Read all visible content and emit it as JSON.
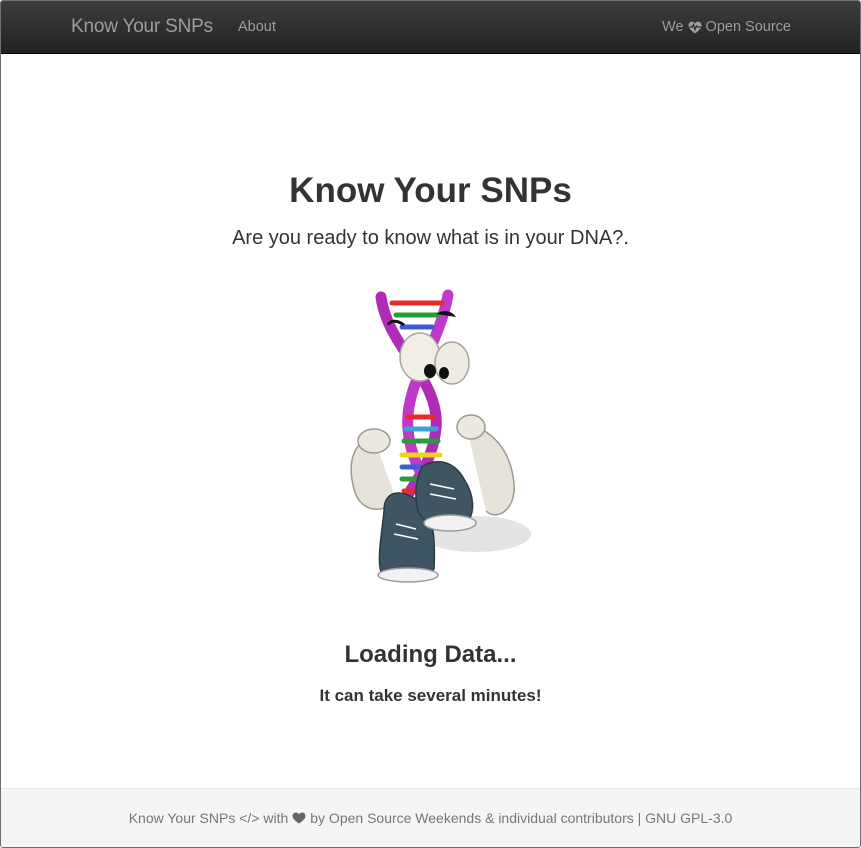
{
  "navbar": {
    "brand": "Know Your SNPs",
    "about": "About",
    "right_prefix": "We",
    "right_icon": "heart-pulse-icon",
    "right_suffix": "Open Source"
  },
  "main": {
    "title": "Know Your SNPs",
    "subtitle": "Are you ready to know what is in your DNA?.",
    "mascot_image": "dna-mascot",
    "loading": "Loading Data...",
    "note": "It can take several minutes!"
  },
  "footer": {
    "part1": "Know Your SNPs </> with",
    "icon": "heart-icon",
    "part2": "by Open Source Weekends & individual contributors | GNU GPL-3.0"
  }
}
